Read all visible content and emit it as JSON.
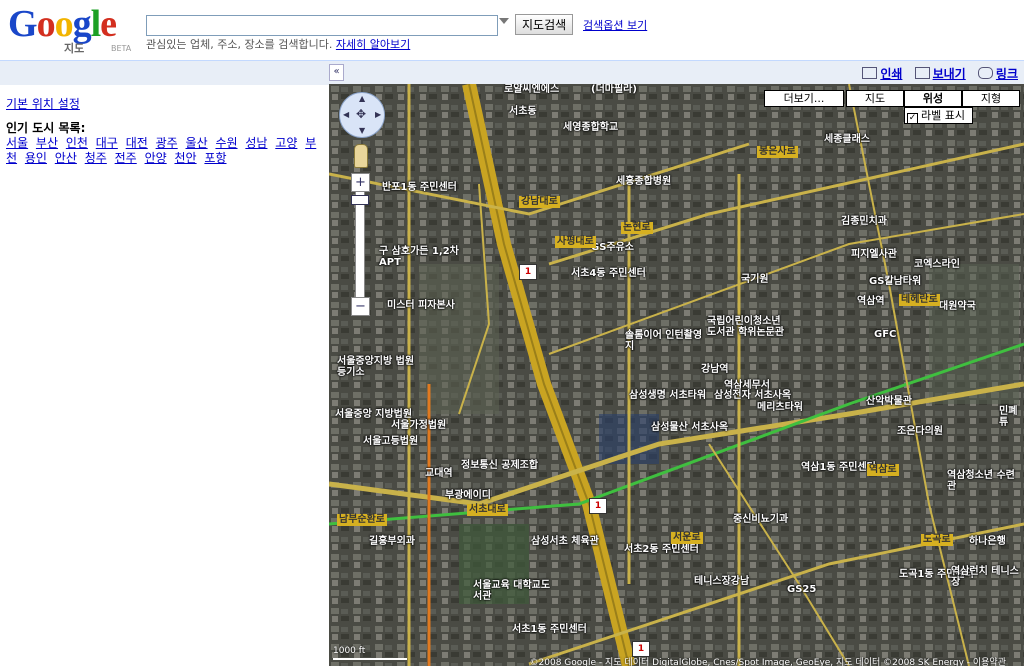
{
  "header": {
    "logo_text": "Google",
    "logo_sub": "지도",
    "logo_beta": "BETA",
    "search_value": "",
    "search_button": "지도검색",
    "search_options_link": "검색옵션 보기",
    "search_hint": "관심있는 업체, 주소, 장소를 검색합니다.",
    "search_hint_link": "자세히 알아보기"
  },
  "toolbar": {
    "collapse": "«",
    "print": "인쇄",
    "send": "보내기",
    "link": "링크"
  },
  "sidebar": {
    "default_location": "기본 위치 설정",
    "cities_heading": "인기 도시 목록:",
    "cities": [
      "서울",
      "부산",
      "인천",
      "대구",
      "대전",
      "광주",
      "울산",
      "수원",
      "성남",
      "고양",
      "부천",
      "용인",
      "안산",
      "청주",
      "전주",
      "안양",
      "천안",
      "포항"
    ]
  },
  "map": {
    "map_types": {
      "more": "더보기...",
      "map": "지도",
      "satellite": "위성",
      "terrain": "지형"
    },
    "labels_toggle": "라벨 표시",
    "labels_checked": "✓",
    "zoom_in": "+",
    "zoom_out": "−",
    "scale": "1000 ft",
    "copyright": "©2008 Google - 지도 데이터 DigitalGlobe, Cnes/Spot Image, GeoEye, 지도 데이터 ©2008 SK Energy - 이용약관",
    "labels": [
      "로얄씨엔에스",
      "(더마필라)",
      "서초동",
      "세영종합학교",
      "세종클래스",
      "반포1동 주민센터",
      "세흥종합병원",
      "김종민치과",
      "구 삼호가든 1,2차 APT",
      "GS주유소",
      "서초4동 주민센터",
      "피지엘사관",
      "코엑스라인",
      "GS칼남타워",
      "국기원",
      "역삼역",
      "미스터 피자본사",
      "국립어린이청소년 도서관 학위논문관",
      "GFC",
      "대원약국",
      "솔롬이어 인턴촬영지",
      "강남역",
      "역삼세무서",
      "서울중앙지방 법원등기소",
      "삼성생명 서초타워",
      "삼성전자 서초사옥",
      "메리츠타워",
      "산악박물관",
      "서울중앙 지방법원",
      "서울가정법원",
      "삼성물산 서초사옥",
      "조은다의원",
      "서울고등법원",
      "교대역",
      "정보통신 공제조합",
      "역삼1동 주민센터",
      "역삼청소년 수련관",
      "부광에이디",
      "삼성서초 체육관",
      "서초2동 주민센터",
      "중신비뇨기과",
      "길흥부외과",
      "테니스장강남",
      "GS25",
      "서울교육 대학교도서관",
      "서초1동 주민센터",
      "도곡1동 주민센터",
      "역삼런치 테니스장",
      "하나은행",
      "민폐튜"
    ],
    "road_labels": [
      "남부순환로",
      "서초대로",
      "강남대로",
      "테헤란로",
      "사평대로",
      "봉은사로",
      "논현로",
      "역삼로",
      "도곡로",
      "서운로"
    ]
  },
  "colors": {
    "link": "#0000cc",
    "toolbar_bg": "#e8eef7",
    "road_yellow": "#d6b021",
    "subway_green": "#3fbf3f"
  },
  "icons": [
    "print-icon",
    "email-icon",
    "link-icon",
    "pan-arrows-icon",
    "pegman-icon",
    "zoom-in-icon",
    "zoom-out-icon",
    "checkbox-icon",
    "dropdown-arrow-icon",
    "collapse-arrow-icon"
  ]
}
